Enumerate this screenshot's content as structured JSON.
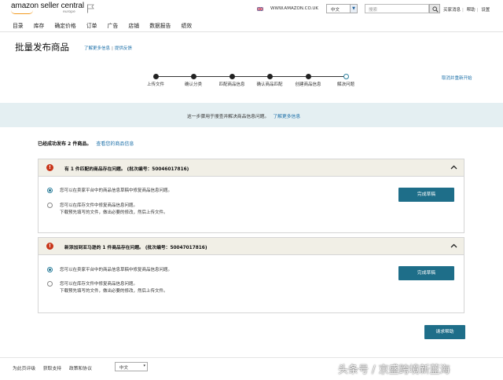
{
  "header": {
    "logo_text": "amazon seller central",
    "logo_region": "europe",
    "domain": "WWW.AMAZON.CO.UK",
    "language": "中文",
    "search_placeholder": "搜索",
    "links": [
      "买家消息",
      "帮助",
      "设置"
    ]
  },
  "nav": {
    "items": [
      "目录",
      "库存",
      "确定价格",
      "订单",
      "广告",
      "店铺",
      "数据报告",
      "绩效"
    ]
  },
  "page": {
    "title": "批量发布商品",
    "link_learn_more": "了解更多信息",
    "link_feedback": "提供反馈",
    "cancel_restart": "取消并重新开始"
  },
  "progress": {
    "steps": [
      "上传文件",
      "确认分类",
      "匹配商品信息",
      "确认商品匹配",
      "创建商品信息",
      "解决问题"
    ],
    "current_step": 6
  },
  "info_banner": {
    "text": "这一步骤用于搜查并解决商品信息问题。",
    "link": "了解更多信息"
  },
  "success": {
    "text": "已经成功发布 2 件商品。",
    "link": "查看您的商品信息"
  },
  "cards": [
    {
      "title": "有 1 件匹配的商品存在问题。 (批次编号：50046017816)",
      "option1": "您可以在卖家平台中的商品信息草稿中修复商品信息问题。",
      "option2_line1": "您可以在库存文件中修复商品信息问题。",
      "option2_line2": "下载预先填写的文件，做出必要的修改，然后上传文件。",
      "button": "完成草稿"
    },
    {
      "title": "新添加到亚马逊的 1 件商品存在问题。 (批次编号：50047017816)",
      "option1": "您可以在卖家平台中的商品信息草稿中修复商品信息问题。",
      "option2_line1": "您可以在库存文件中修复商品信息问题。",
      "option2_line2": "下载预先填写的文件，做出必要的修改，然后上传文件。",
      "button": "完成草稿"
    }
  ],
  "help_button": "请求帮助",
  "footer": {
    "links": [
      "为此页评级",
      "获取支持",
      "政策和协议"
    ],
    "language": "中文"
  },
  "watermark": "头条号 / 京盛跨境新蓝海",
  "colors": {
    "accent": "#1e6e89",
    "link": "#1b6fa8",
    "warning": "#c8361a",
    "banner": "#e4eff2"
  }
}
